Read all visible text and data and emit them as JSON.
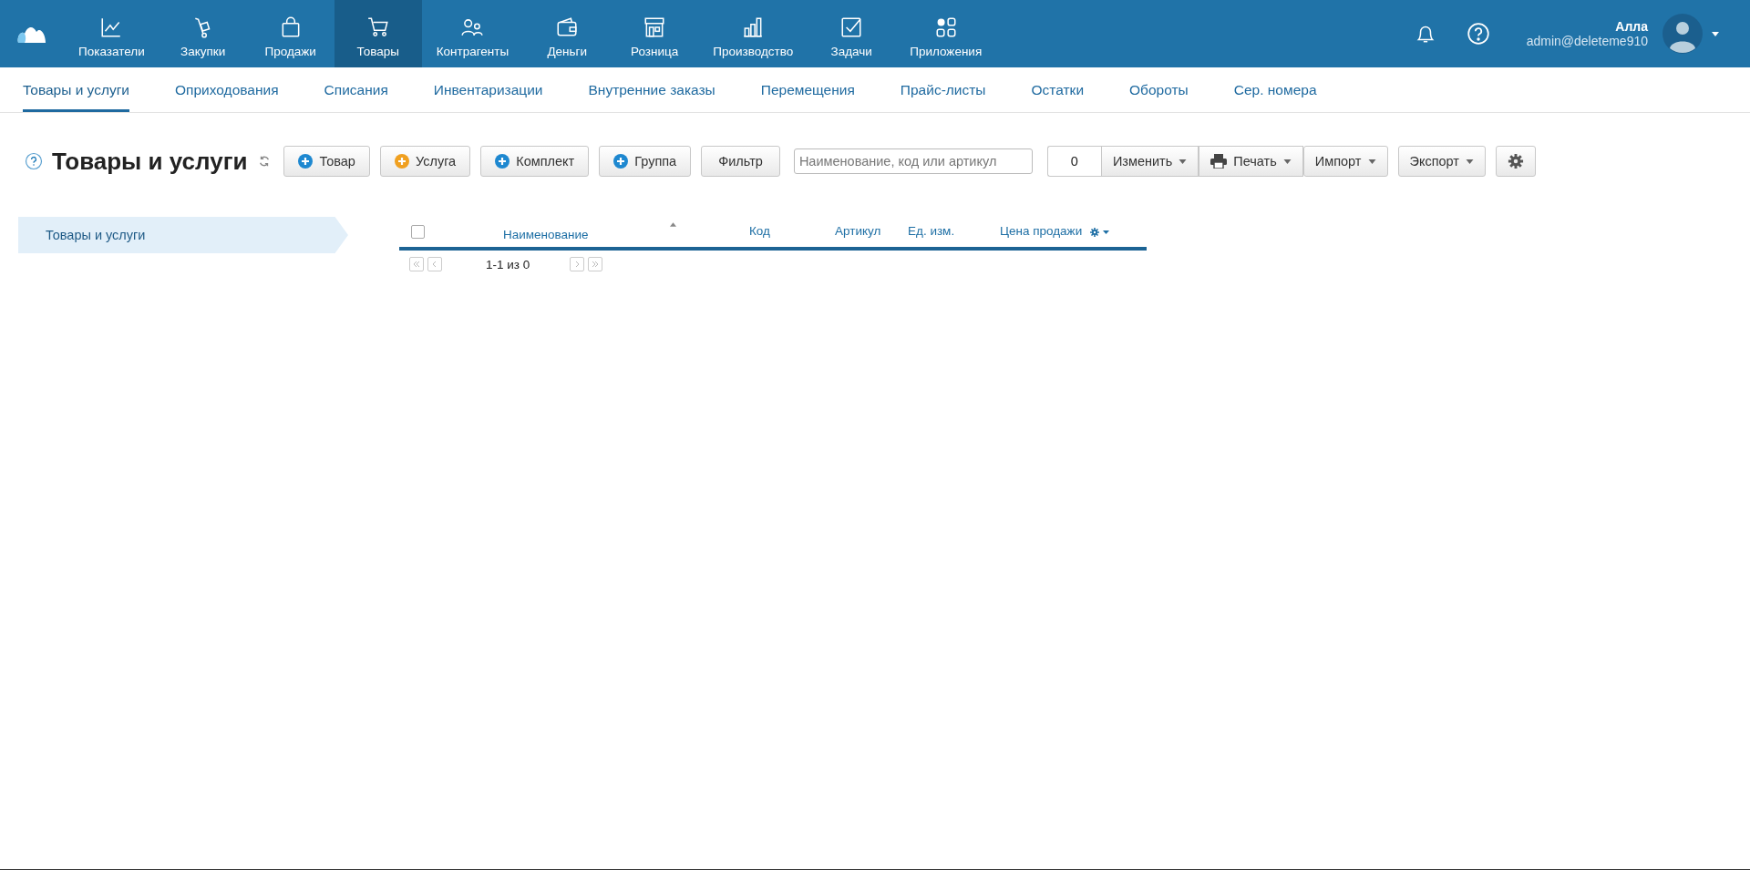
{
  "nav": [
    {
      "label": "Показатели",
      "selected": false
    },
    {
      "label": "Закупки",
      "selected": false
    },
    {
      "label": "Продажи",
      "selected": false
    },
    {
      "label": "Товары",
      "selected": true
    },
    {
      "label": "Контрагенты",
      "selected": false
    },
    {
      "label": "Деньги",
      "selected": false
    },
    {
      "label": "Розница",
      "selected": false
    },
    {
      "label": "Производство",
      "selected": false
    },
    {
      "label": "Задачи",
      "selected": false
    },
    {
      "label": "Приложения",
      "selected": false
    }
  ],
  "user": {
    "name": "Алла",
    "account": "admin@deleteme910"
  },
  "subnav": [
    {
      "label": "Товары и услуги",
      "selected": true
    },
    {
      "label": "Оприходования",
      "selected": false
    },
    {
      "label": "Списания",
      "selected": false
    },
    {
      "label": "Инвентаризации",
      "selected": false
    },
    {
      "label": "Внутренние заказы",
      "selected": false
    },
    {
      "label": "Перемещения",
      "selected": false
    },
    {
      "label": "Прайс-листы",
      "selected": false
    },
    {
      "label": "Остатки",
      "selected": false
    },
    {
      "label": "Обороты",
      "selected": false
    },
    {
      "label": "Сер. номера",
      "selected": false
    }
  ],
  "page": {
    "title": "Товары и услуги"
  },
  "toolbar": {
    "add_buttons": [
      {
        "label": "Товар",
        "color": "#1e88d0"
      },
      {
        "label": "Услуга",
        "color": "#f0a020"
      },
      {
        "label": "Комплект",
        "color": "#1e88d0"
      },
      {
        "label": "Группа",
        "color": "#1e88d0"
      }
    ],
    "filter": "Фильтр",
    "search": {
      "placeholder": "Наименование, код или артикул"
    },
    "counter": "0",
    "menus": [
      {
        "label": "Изменить",
        "kind": "plain"
      },
      {
        "label": "Печать",
        "kind": "print"
      },
      {
        "label": "Импорт",
        "kind": "plain"
      },
      {
        "label": "Экспорт",
        "kind": "plain"
      }
    ]
  },
  "sidebar": {
    "items": [
      {
        "label": "Товары и услуги",
        "selected": true
      }
    ]
  },
  "table": {
    "select_all": {
      "checked": false
    },
    "columns": [
      {
        "label": "Наименование",
        "sorted": true
      },
      {
        "label": "Код",
        "sorted": false
      },
      {
        "label": "Артикул",
        "sorted": false
      },
      {
        "label": "Ед. изм.",
        "sorted": false
      },
      {
        "label": "Цена продажи",
        "sorted": false
      }
    ],
    "pagination": "1-1 из 0"
  }
}
